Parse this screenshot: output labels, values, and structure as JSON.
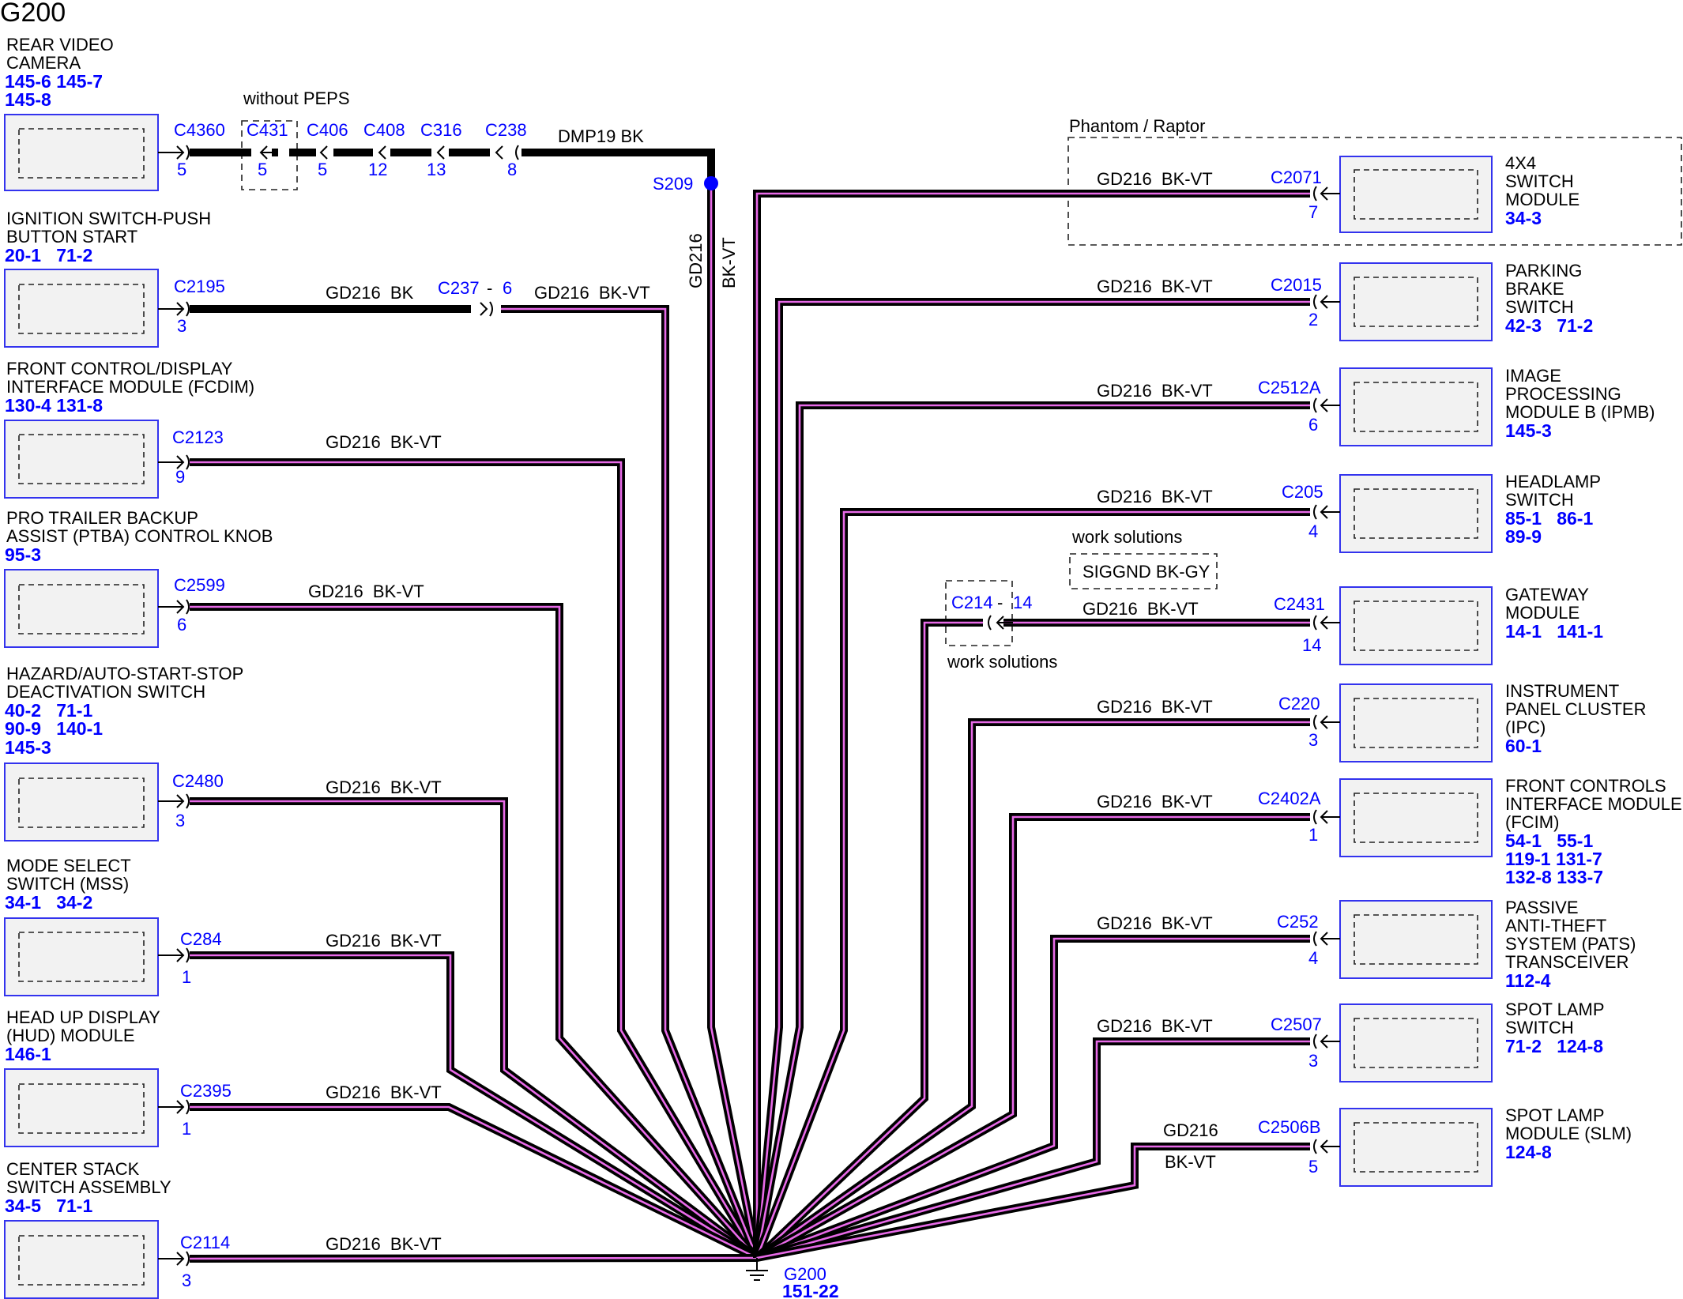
{
  "title": "G200",
  "colors": {
    "wire_ink": "#000000",
    "wire_stripe": "#e86ae8",
    "ref_blue": "#0000ff",
    "module_fill": "#f2f2f2",
    "module_border": "#3333ee"
  },
  "left_modules": [
    {
      "id": "rvc",
      "name_lines": [
        "REAR VIDEO",
        "CAMERA"
      ],
      "refs": [
        "145-6 145-7",
        "145-8"
      ],
      "connector": "C4360",
      "pin": "5",
      "wire": "DMP19 BK"
    },
    {
      "id": "ign",
      "name_lines": [
        "IGNITION SWITCH-PUSH",
        "BUTTON START"
      ],
      "refs": [
        "20-1   71-2"
      ],
      "connector": "C2195",
      "pin": "3",
      "wire_a": "GD216  BK",
      "inline_connector": "C237",
      "inline_pin": "6",
      "wire_b": "GD216  BK-VT"
    },
    {
      "id": "fcdim",
      "name_lines": [
        "FRONT CONTROL/DISPLAY",
        "INTERFACE MODULE (FCDIM)"
      ],
      "refs": [
        "130-4 131-8"
      ],
      "connector": "C2123",
      "pin": "9",
      "wire": "GD216  BK-VT"
    },
    {
      "id": "ptba",
      "name_lines": [
        "PRO TRAILER BACKUP",
        "ASSIST (PTBA) CONTROL KNOB"
      ],
      "refs": [
        "95-3"
      ],
      "connector": "C2599",
      "pin": "6",
      "wire": "GD216  BK-VT"
    },
    {
      "id": "haz",
      "name_lines": [
        "HAZARD/AUTO-START-STOP",
        "DEACTIVATION SWITCH"
      ],
      "refs": [
        "40-2   71-1",
        "90-9   140-1",
        "145-3"
      ],
      "connector": "C2480",
      "pin": "3",
      "wire": "GD216  BK-VT"
    },
    {
      "id": "mss",
      "name_lines": [
        "MODE SELECT",
        "SWITCH (MSS)"
      ],
      "refs": [
        "34-1   34-2"
      ],
      "connector": "C284",
      "pin": "1",
      "wire": "GD216  BK-VT"
    },
    {
      "id": "hud",
      "name_lines": [
        "HEAD UP DISPLAY",
        "(HUD) MODULE"
      ],
      "refs": [
        "146-1"
      ],
      "connector": "C2395",
      "pin": "1",
      "wire": "GD216  BK-VT"
    },
    {
      "id": "cssa",
      "name_lines": [
        "CENTER STACK",
        "SWITCH ASSEMBLY"
      ],
      "refs": [
        "34-5   71-1"
      ],
      "connector": "C2114",
      "pin": "3",
      "wire": "GD216  BK-VT"
    }
  ],
  "rvc_inline": [
    {
      "connector": "C431",
      "pin": "5"
    },
    {
      "connector": "C406",
      "pin": "5"
    },
    {
      "connector": "C408",
      "pin": "12"
    },
    {
      "connector": "C316",
      "pin": "13"
    },
    {
      "connector": "C238",
      "pin": "8"
    }
  ],
  "without_peps_label": "without PEPS",
  "splice": {
    "id": "S209",
    "wire": "GD216",
    "color": "BK-VT"
  },
  "right_modules": [
    {
      "id": "4x4",
      "name_lines": [
        "4X4",
        "SWITCH",
        "MODULE"
      ],
      "refs": [
        "34-3"
      ],
      "connector": "C2071",
      "pin": "7",
      "wire": "GD216  BK-VT"
    },
    {
      "id": "pbs",
      "name_lines": [
        "PARKING",
        "BRAKE",
        "SWITCH"
      ],
      "refs": [
        "42-3   71-2"
      ],
      "connector": "C2015",
      "pin": "2",
      "wire": "GD216  BK-VT"
    },
    {
      "id": "ipmb",
      "name_lines": [
        "IMAGE",
        "PROCESSING",
        "MODULE B (IPMB)"
      ],
      "refs": [
        "145-3"
      ],
      "connector": "C2512A",
      "pin": "6",
      "wire": "GD216  BK-VT"
    },
    {
      "id": "hls",
      "name_lines": [
        "HEADLAMP",
        "SWITCH"
      ],
      "refs": [
        "85-1   86-1",
        "89-9"
      ],
      "connector": "C205",
      "pin": "4",
      "wire": "GD216  BK-VT"
    },
    {
      "id": "gwm",
      "name_lines": [
        "GATEWAY",
        "MODULE"
      ],
      "refs": [
        "14-1   141-1"
      ],
      "connector": "C2431",
      "pin": "14",
      "wire": "GD216  BK-VT"
    },
    {
      "id": "ipc",
      "name_lines": [
        "INSTRUMENT",
        "PANEL CLUSTER",
        "(IPC)"
      ],
      "refs": [
        "60-1"
      ],
      "connector": "C220",
      "pin": "3",
      "wire": "GD216  BK-VT"
    },
    {
      "id": "fcim",
      "name_lines": [
        "FRONT CONTROLS",
        "INTERFACE MODULE",
        "(FCIM)"
      ],
      "refs": [
        "54-1   55-1",
        "119-1 131-7",
        "132-8 133-7"
      ],
      "connector": "C2402A",
      "pin": "1",
      "wire": "GD216  BK-VT"
    },
    {
      "id": "pats",
      "name_lines": [
        "PASSIVE",
        "ANTI-THEFT",
        "SYSTEM (PATS)",
        "TRANSCEIVER"
      ],
      "refs": [
        "112-4"
      ],
      "connector": "C252",
      "pin": "4",
      "wire": "GD216  BK-VT"
    },
    {
      "id": "sls",
      "name_lines": [
        "SPOT LAMP",
        "SWITCH"
      ],
      "refs": [
        "71-2   124-8"
      ],
      "connector": "C2507",
      "pin": "3",
      "wire": "GD216  BK-VT"
    },
    {
      "id": "slm",
      "name_lines": [
        "SPOT LAMP",
        "MODULE (SLM)"
      ],
      "refs": [
        "124-8"
      ],
      "connector": "C2506B",
      "pin": "5",
      "wire_a": "GD216",
      "wire_b": "BK-VT"
    }
  ],
  "phantom_raptor_label": "Phantom / Raptor",
  "work_solutions_top": "work solutions",
  "work_solutions_bottom": "work solutions",
  "sig_gnd_box": "SIGGND BK-GY",
  "gateway_inline": {
    "connector": "C214",
    "pin": "14"
  },
  "ground": {
    "name": "G200",
    "ref": "151-22"
  }
}
